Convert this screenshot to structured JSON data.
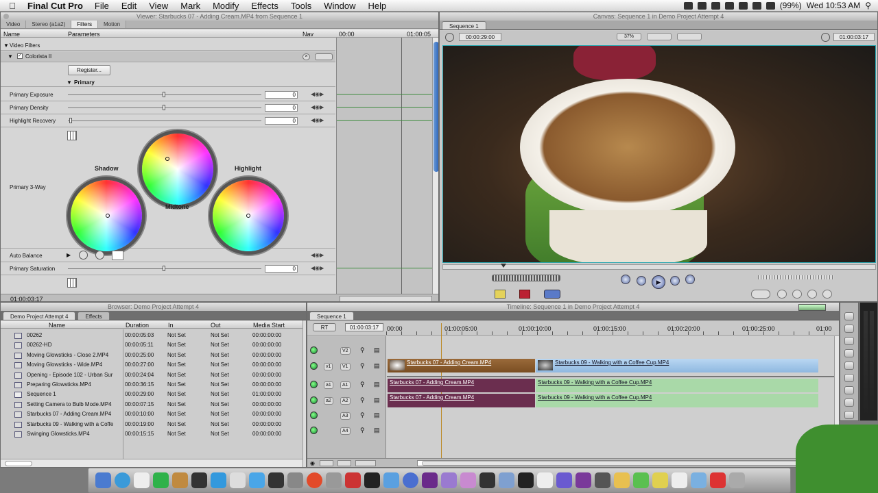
{
  "menubar": {
    "app": "Final Cut Pro",
    "items": [
      "File",
      "Edit",
      "View",
      "Mark",
      "Modify",
      "Effects",
      "Tools",
      "Window",
      "Help"
    ],
    "battery": "(99%)",
    "clock": "Wed 10:53 AM"
  },
  "viewer": {
    "title": "Viewer: Starbucks 07 - Adding Cream.MP4 from Sequence 1",
    "tabs": [
      "Video",
      "Stereo (a1a2)",
      "Filters",
      "Motion"
    ],
    "active_tab": "Filters",
    "col_name": "Name",
    "col_params": "Parameters",
    "col_nav": "Nav",
    "tc_start": "00:00",
    "tc_end": "01:00:05",
    "group": "Video Filters",
    "filter": "Colorista II",
    "register": "Register...",
    "section": "Primary",
    "params": [
      {
        "label": "Primary Exposure",
        "value": "0"
      },
      {
        "label": "Primary Density",
        "value": "0"
      },
      {
        "label": "Highlight Recovery",
        "value": "0"
      }
    ],
    "three_way": "Primary 3-Way",
    "shadow": "Shadow",
    "midtone": "Midtone",
    "highlight": "Highlight",
    "auto_balance": "Auto Balance",
    "saturation": {
      "label": "Primary Saturation",
      "value": "0"
    },
    "timecode": "01:00:03:17"
  },
  "canvas": {
    "title": "Canvas: Sequence 1 in Demo Project Attempt 4",
    "tab": "Sequence 1",
    "duration": "00:00:29:00",
    "zoom": "37%",
    "timecode": "01:00:03:17"
  },
  "browser": {
    "title": "Browser: Demo Project Attempt 4",
    "tabs": [
      "Demo Project Attempt 4",
      "Effects"
    ],
    "columns": [
      "Name",
      "Duration",
      "In",
      "Out",
      "Media Start"
    ],
    "rows": [
      {
        "name": "00262",
        "dur": "00:00:05:03",
        "in": "Not Set",
        "out": "Not Set",
        "ms": "00:00:00:00"
      },
      {
        "name": "00262-HD",
        "dur": "00:00:05:11",
        "in": "Not Set",
        "out": "Not Set",
        "ms": "00:00:00:00"
      },
      {
        "name": "Moving Glowsticks - Close 2.MP4",
        "dur": "00:00:25:00",
        "in": "Not Set",
        "out": "Not Set",
        "ms": "00:00:00:00"
      },
      {
        "name": "Moving Glowsticks - Wide.MP4",
        "dur": "00:00:27:00",
        "in": "Not Set",
        "out": "Not Set",
        "ms": "00:00:00:00"
      },
      {
        "name": "Opening - Episode 102 - Urban Sur",
        "dur": "00:00:24:04",
        "in": "Not Set",
        "out": "Not Set",
        "ms": "00:00:00:00"
      },
      {
        "name": "Preparing Glowsticks.MP4",
        "dur": "00:00:36:15",
        "in": "Not Set",
        "out": "Not Set",
        "ms": "00:00:00:00"
      },
      {
        "name": "Sequence 1",
        "dur": "00:00:29:00",
        "in": "Not Set",
        "out": "Not Set",
        "ms": "01:00:00:00"
      },
      {
        "name": "Setting Camera to Bulb Mode.MP4",
        "dur": "00:00:07:15",
        "in": "Not Set",
        "out": "Not Set",
        "ms": "00:00:00:00"
      },
      {
        "name": "Starbucks 07 - Adding Cream.MP4",
        "dur": "00:00:10:00",
        "in": "Not Set",
        "out": "Not Set",
        "ms": "00:00:00:00"
      },
      {
        "name": "Starbucks 09 - Walking with a Coffe",
        "dur": "00:00:19:00",
        "in": "Not Set",
        "out": "Not Set",
        "ms": "00:00:00:00"
      },
      {
        "name": "Swinging Glowsticks.MP4",
        "dur": "00:00:15:15",
        "in": "Not Set",
        "out": "Not Set",
        "ms": "00:00:00:00"
      }
    ]
  },
  "timeline": {
    "title": "Timeline: Sequence 1 in Demo Project Attempt 4",
    "tab": "Sequence 1",
    "rt": "RT",
    "timecode": "01:00:03:17",
    "ruler": [
      "00:00",
      "01:00:05:00",
      "01:00:10:00",
      "01:00:15:00",
      "01:00:20:00",
      "01:00:25:00",
      "01:00"
    ],
    "tracks": {
      "v2": "V2",
      "v1a": "v1",
      "v1": "V1",
      "a1a": "a1",
      "a1": "A1",
      "a2a": "a2",
      "a2": "A2",
      "a3": "A3",
      "a4": "A4"
    },
    "clips": {
      "v1_a": "Starbucks 07 - Adding Cream.MP4",
      "v1_b": "Starbucks 09 - Walking with a Coffee Cup.MP4",
      "a1_a": "Starbucks 07 - Adding Cream.MP4",
      "a1_b": "Starbucks 09 - Walking with a Coffee Cup.MP4",
      "a2_a": "Starbucks 07 - Adding Cream.MP4",
      "a2_b": "Starbucks 09 - Walking with a Coffee Cup.MP4"
    }
  },
  "colors": {
    "video_clip": "#a9c9e8",
    "audio_clip_a": "#6b2e4f",
    "audio_clip_b": "#a9d9a8",
    "accent_green": "#3a8a3a"
  }
}
